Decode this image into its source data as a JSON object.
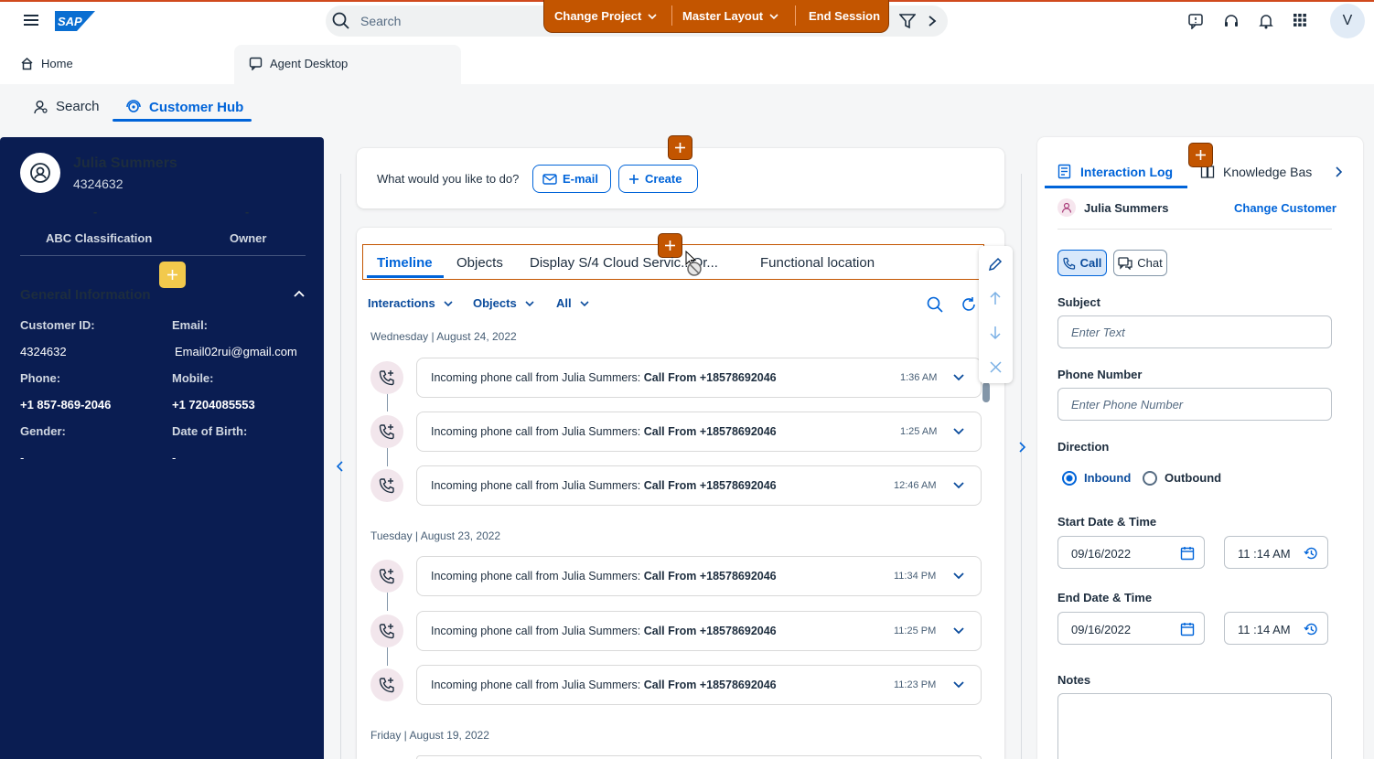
{
  "header": {
    "search_placeholder": "Search",
    "session": {
      "change_project": "Change Project",
      "master_layout": "Master Layout",
      "end_session": "End Session"
    },
    "user_initial": "V"
  },
  "nav": {
    "home": "Home",
    "agent_desktop": "Agent Desktop"
  },
  "subnav": {
    "search": "Search",
    "customer_hub": "Customer Hub"
  },
  "customer": {
    "name": "Julia Summers",
    "id": "4324632",
    "abc_classification_value": "-",
    "abc_classification_label": "ABC Classification",
    "owner_value": "-",
    "owner_label": "Owner",
    "general_info_title": "General Information",
    "fields": {
      "customer_id_label": "Customer ID:",
      "customer_id": "4324632",
      "email_label": "Email:",
      "email": "Email02rui@gmail.com",
      "phone_label": "Phone:",
      "phone": "+1 857-869-2046",
      "mobile_label": "Mobile:",
      "mobile": "+1 7204085553",
      "gender_label": "Gender:",
      "gender": "-",
      "dob_label": "Date of Birth:",
      "dob": "-"
    }
  },
  "actions": {
    "prompt": "What would you like to do?",
    "email": "E-mail",
    "create": "Create"
  },
  "timeline": {
    "tabs": [
      "Timeline",
      "Objects",
      "Display S/4 Cloud Servic...Or...",
      "Functional location"
    ],
    "filters": [
      "Interactions",
      "Objects",
      "All"
    ],
    "groups": [
      {
        "day": "Wednesday | August 24, 2022",
        "entries": [
          {
            "text": "Incoming phone call from Julia Summers: ",
            "bold": "Call From +18578692046",
            "time": "1:36 AM"
          },
          {
            "text": "Incoming phone call from Julia Summers: ",
            "bold": "Call From +18578692046",
            "time": "1:25 AM"
          },
          {
            "text": "Incoming phone call from Julia Summers: ",
            "bold": "Call From +18578692046",
            "time": "12:46 AM"
          }
        ]
      },
      {
        "day": "Tuesday | August 23, 2022",
        "entries": [
          {
            "text": "Incoming phone call from Julia Summers: ",
            "bold": "Call From +18578692046",
            "time": "11:34 PM"
          },
          {
            "text": "Incoming phone call from Julia Summers: ",
            "bold": "Call From +18578692046",
            "time": "11:25 PM"
          },
          {
            "text": "Incoming phone call from Julia Summers: ",
            "bold": "Call From +18578692046",
            "time": "11:23 PM"
          }
        ]
      },
      {
        "day": "Friday | August 19, 2022",
        "entries": []
      }
    ]
  },
  "interaction_log": {
    "tab_active": "Interaction Log",
    "tab_next": "Knowledge Bas",
    "customer_name": "Julia Summers",
    "change_customer": "Change Customer",
    "channel_call": "Call",
    "channel_chat": "Chat",
    "subject_label": "Subject",
    "subject_placeholder": "Enter Text",
    "phone_label": "Phone Number",
    "phone_placeholder": "Enter Phone Number",
    "direction_label": "Direction",
    "inbound": "Inbound",
    "outbound": "Outbound",
    "start_label": "Start Date & Time",
    "start_date": "09/16/2022",
    "start_time": "11 :14  AM",
    "end_label": "End Date & Time",
    "end_date": "09/16/2022",
    "end_time": "11 :14  AM",
    "notes_label": "Notes"
  },
  "colors": {
    "brand_blue": "#0064d9",
    "session_orange": "#c35500",
    "panel_navy": "#0a1d52",
    "highlight_yellow": "#f2c94c"
  }
}
